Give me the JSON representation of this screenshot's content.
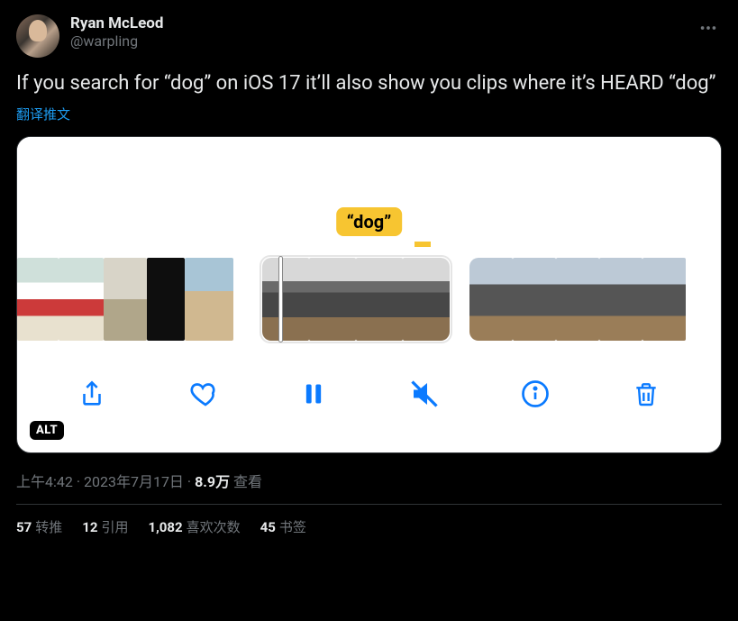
{
  "author": {
    "display_name": "Ryan McLeod",
    "handle": "@warpling"
  },
  "tweet": {
    "text": "If you search for “dog” on iOS 17 it’ll also show you clips where it’s HEARD “dog”",
    "translate_label": "翻译推文"
  },
  "media": {
    "badge_text": "“dog”",
    "alt_label": "ALT"
  },
  "meta": {
    "time": "上午4:42",
    "date": "2023年7月17日",
    "separator": " · ",
    "views_count": "8.9万",
    "views_label": " 查看"
  },
  "stats": {
    "retweets_count": "57",
    "retweets_label": "转推",
    "quotes_count": "12",
    "quotes_label": "引用",
    "likes_count": "1,082",
    "likes_label": "喜欢次数",
    "bookmarks_count": "45",
    "bookmarks_label": "书签"
  }
}
